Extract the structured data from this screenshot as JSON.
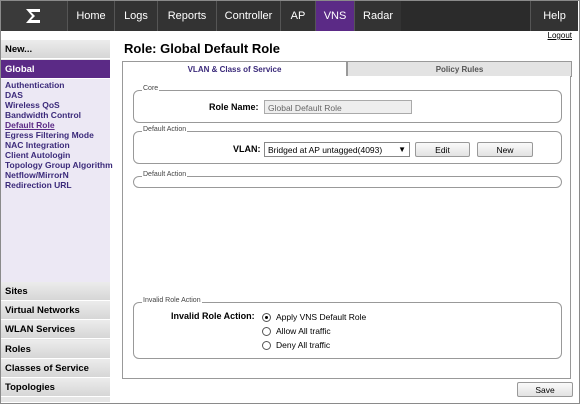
{
  "nav": {
    "logo_icon": "extreme-networks-logo",
    "tabs": [
      "Home",
      "Logs",
      "Reports",
      "Controller",
      "AP",
      "VNS",
      "Radar"
    ],
    "active_tab": "VNS",
    "help": "Help",
    "logout": "Logout"
  },
  "sidebar": {
    "top": "New...",
    "active_section": "Global",
    "sub_items": [
      "Authentication",
      "DAS",
      "Wireless QoS",
      "Bandwidth Control",
      "Default Role",
      "Egress Filtering Mode",
      "NAC Integration",
      "Client Autologin",
      "Topology Group Algorithm",
      "Netflow/MirrorN",
      "Redirection URL"
    ],
    "current_sub_item": "Default Role",
    "sections": [
      "Sites",
      "Virtual Networks",
      "WLAN Services",
      "Roles",
      "Classes of Service",
      "Topologies"
    ]
  },
  "main": {
    "title": "Role: Global Default Role",
    "tabs": [
      "VLAN & Class of Service",
      "Policy Rules"
    ],
    "active_tab": "VLAN & Class of Service",
    "core": {
      "legend": "Core",
      "role_name_label": "Role Name:",
      "role_name_value": "Global Default Role"
    },
    "default_action_1": {
      "legend": "Default Action",
      "vlan_label": "VLAN:",
      "vlan_selected": "Bridged at AP untagged(4093)",
      "edit": "Edit",
      "new": "New"
    },
    "default_action_2": {
      "legend": "Default Action"
    },
    "invalid_role": {
      "legend": "Invalid Role Action",
      "label": "Invalid Role Action:",
      "options": [
        "Apply VNS Default Role",
        "Allow All traffic",
        "Deny All traffic"
      ],
      "selected": "Apply VNS Default Role"
    },
    "save": "Save"
  },
  "colors": {
    "accent": "#5b2a86",
    "nav_bg": "#2b2b2b"
  }
}
